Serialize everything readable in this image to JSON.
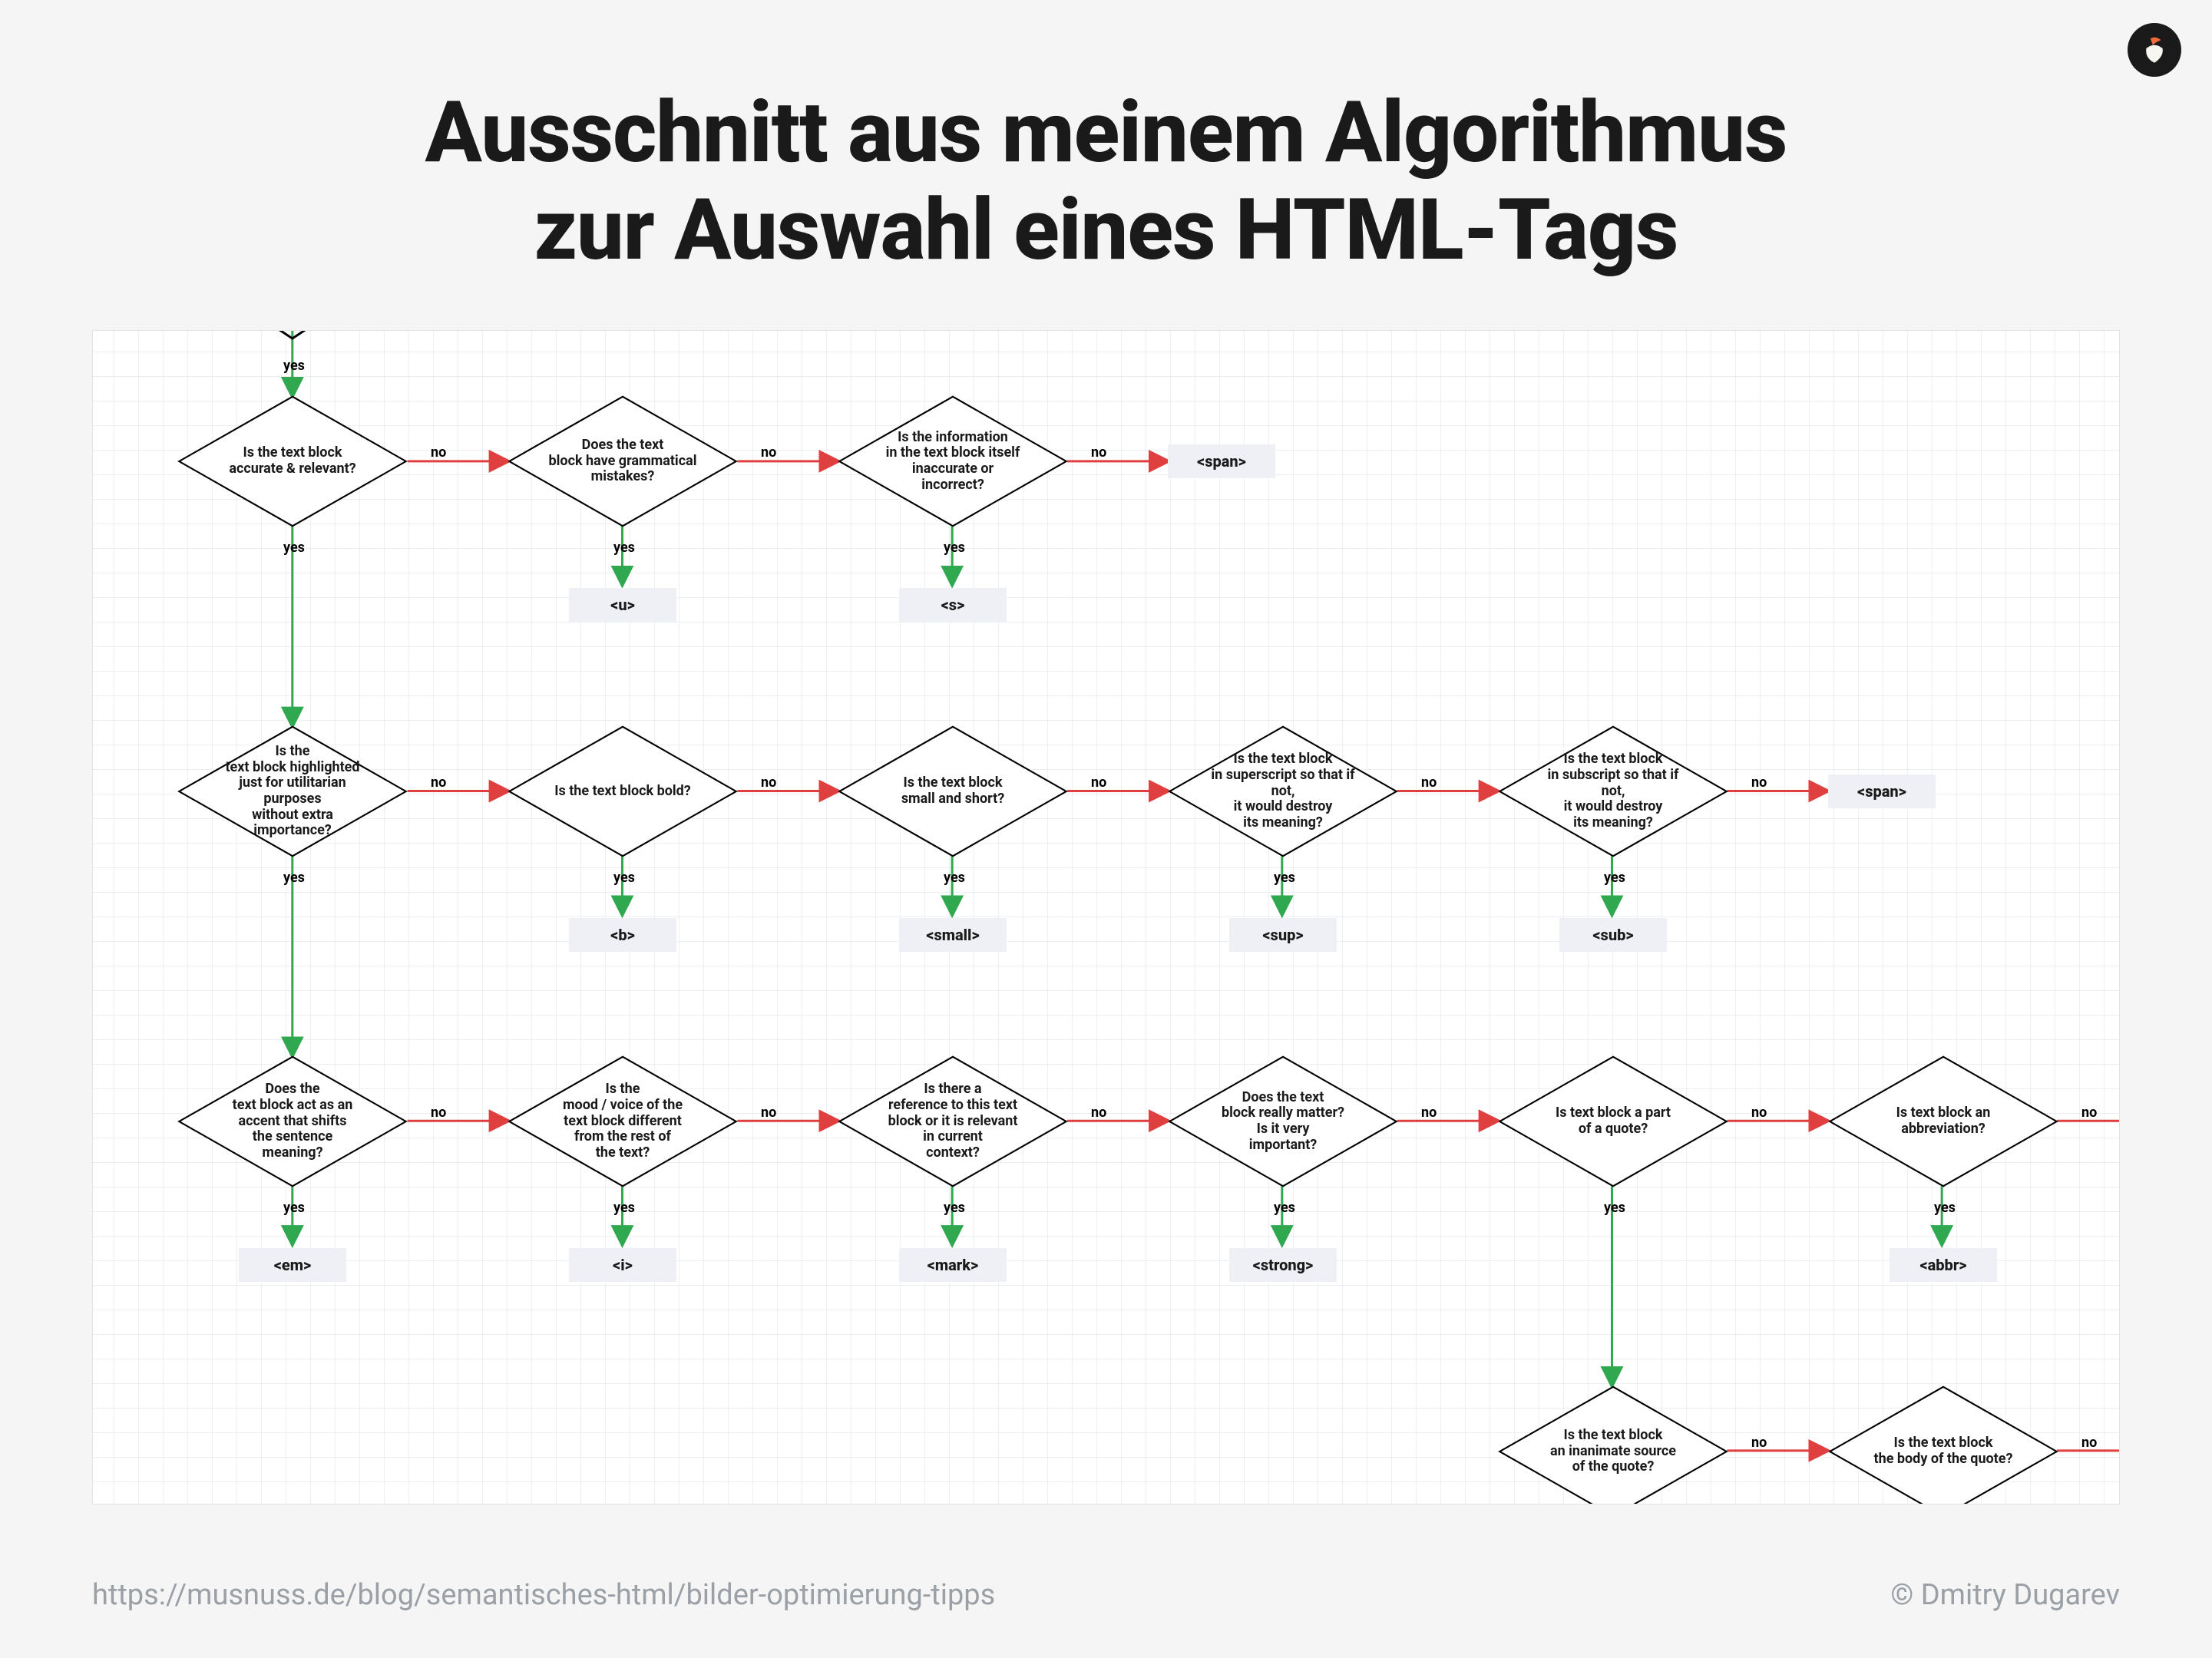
{
  "title_line1": "Ausschnitt aus meinem Algorithmus",
  "title_line2": "zur Auswahl eines HTML-Tags",
  "footer_url": "https://musnuss.de/blog/semantisches-html/bilder-optimierung-tipps",
  "footer_credit": "© Dmitry Dugarev",
  "labels": {
    "yes": "yes",
    "no": "no"
  },
  "colors": {
    "yes": "#2fa84f",
    "no": "#e03f3f",
    "stroke": "#000000",
    "terminal_bg": "#eef0f5"
  },
  "row0": {
    "d1": "Is the text block\naccurate & relevant?",
    "d2": "Does the text\nblock have grammatical\nmistakes?",
    "d3": "Is the information\nin the text block itself\ninaccurate or\nincorrect?",
    "t2": "<u>",
    "t3": "<s>",
    "t_span": "<span>"
  },
  "row1": {
    "d1": "Is the\ntext block highlighted\njust for utilitarian purposes\nwithout extra\nimportance?",
    "d2": "Is the text block bold?",
    "d3": "Is the text block\nsmall and short?",
    "d4": "Is the text block\nin superscript so that if not,\nit would destroy\nits meaning?",
    "d5": "Is the text block\nin subscript so that if not,\nit would destroy\nits meaning?",
    "t2": "<b>",
    "t3": "<small>",
    "t4": "<sup>",
    "t5": "<sub>",
    "t_span": "<span>"
  },
  "row2": {
    "d1": "Does the\ntext block act as an\naccent that shifts\nthe sentence\nmeaning?",
    "d2": "Is the\nmood / voice of the\ntext block different\nfrom the rest of\nthe text?",
    "d3": "Is there a\nreference to this text\nblock or it is relevant\nin current\ncontext?",
    "d4": "Does the text\nblock really matter?\nIs it very\nimportant?",
    "d5": "Is text block a part\nof a quote?",
    "d6": "Is text block an abbreviation?",
    "t1": "<em>",
    "t2": "<i>",
    "t3": "<mark>",
    "t4": "<strong>",
    "t6": "<abbr>"
  },
  "row3": {
    "d5": "Is the text block\nan inanimate source\nof the quote?",
    "d6": "Is the text block\nthe body of the quote?"
  }
}
